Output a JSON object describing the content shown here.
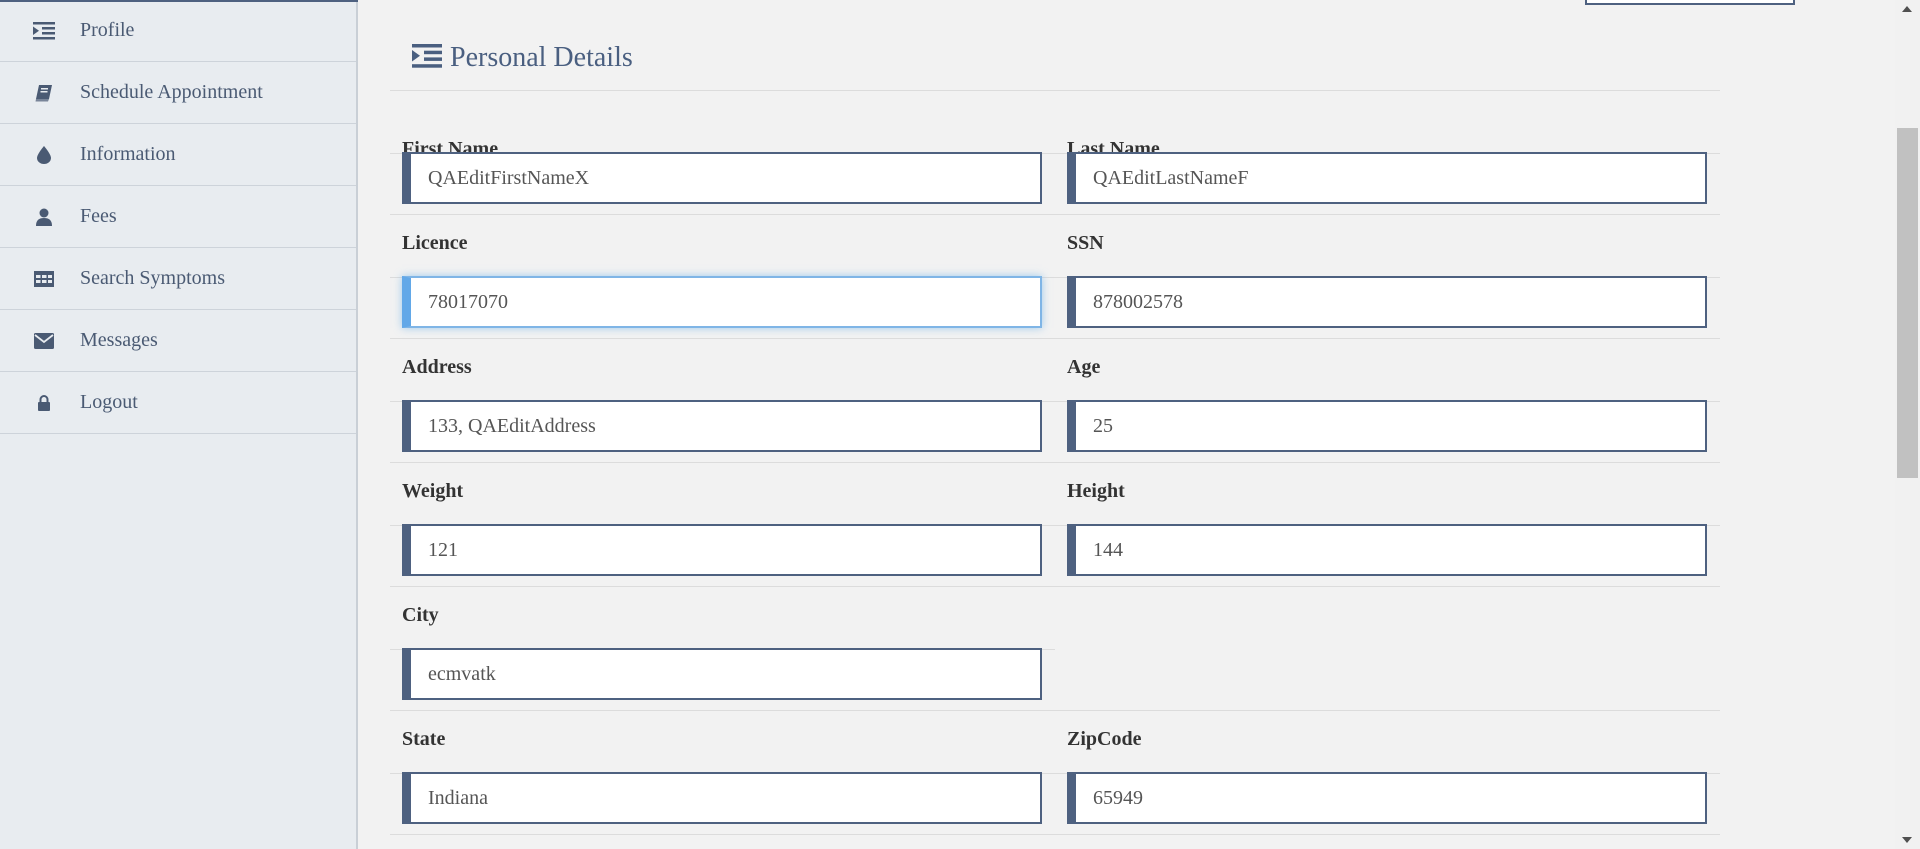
{
  "sidebar": {
    "items": [
      {
        "label": "Profile",
        "icon": "indent-icon"
      },
      {
        "label": "Schedule Appointment",
        "icon": "book-icon"
      },
      {
        "label": "Information",
        "icon": "droplet-icon"
      },
      {
        "label": "Fees",
        "icon": "user-icon"
      },
      {
        "label": "Search Symptoms",
        "icon": "table-icon"
      },
      {
        "label": "Messages",
        "icon": "envelope-icon"
      },
      {
        "label": "Logout",
        "icon": "lock-icon"
      }
    ]
  },
  "panel": {
    "title": "Personal Details",
    "title_icon": "indent-icon"
  },
  "form": {
    "first_name": {
      "label": "First Name",
      "value": "QAEditFirstNameX"
    },
    "last_name": {
      "label": "Last Name",
      "value": "QAEditLastNameF"
    },
    "licence": {
      "label": "Licence",
      "value": "78017070"
    },
    "ssn": {
      "label": "SSN",
      "value": "878002578"
    },
    "address": {
      "label": "Address",
      "value": "133, QAEditAddress"
    },
    "age": {
      "label": "Age",
      "value": "25"
    },
    "weight": {
      "label": "Weight",
      "value": "121"
    },
    "height": {
      "label": "Height",
      "value": "144"
    },
    "city": {
      "label": "City",
      "value": "ecmvatk"
    },
    "state": {
      "label": "State",
      "value": "Indiana"
    },
    "zipcode": {
      "label": "ZipCode",
      "value": "65949"
    }
  },
  "colors": {
    "accent": "#4e6180",
    "sidebar_bg": "#e8ecf0",
    "focus": "#62a8e8"
  }
}
